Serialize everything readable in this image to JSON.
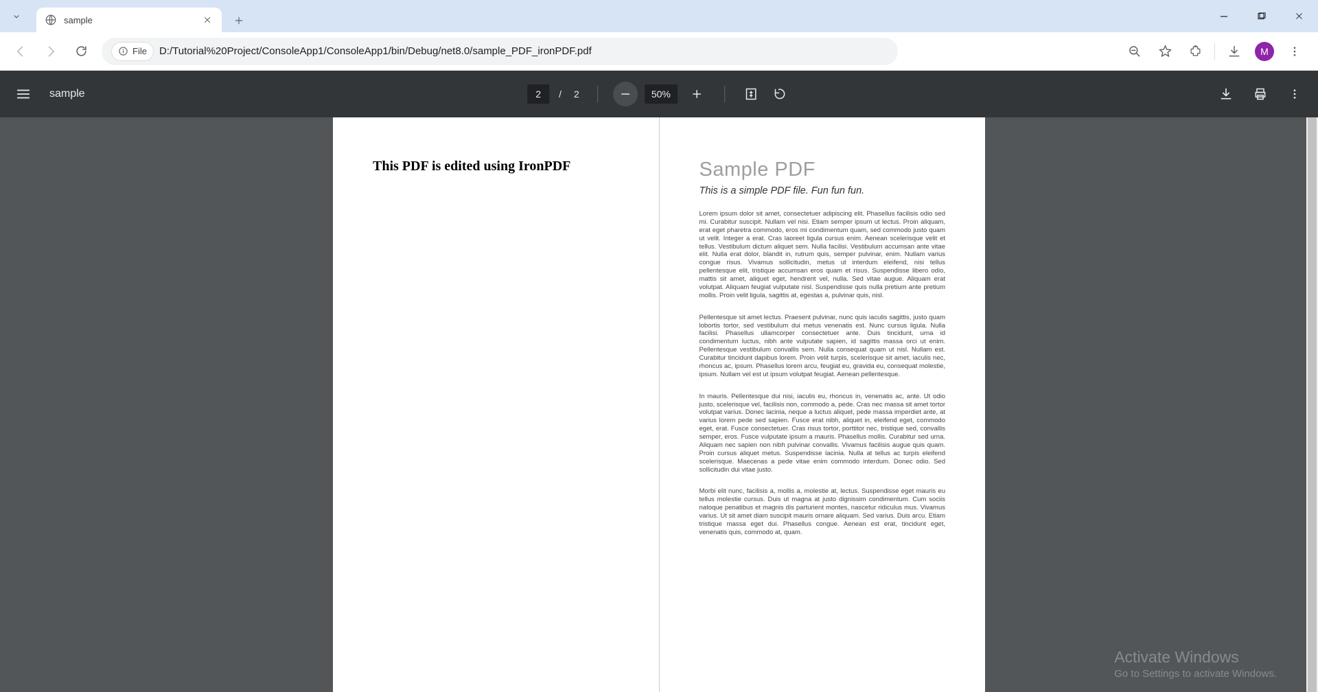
{
  "browser": {
    "tab_title": "sample",
    "url": "D:/Tutorial%20Project/ConsoleApp1/ConsoleApp1/bin/Debug/net8.0/sample_PDF_ironPDF.pdf",
    "origin_chip": "File",
    "avatar_letter": "M"
  },
  "pdf": {
    "doc_title": "sample",
    "page_current": "2",
    "page_sep": "/",
    "page_total": "2",
    "zoom": "50%",
    "left_page": {
      "heading": "This PDF is edited using IronPDF"
    },
    "right_page": {
      "title": "Sample PDF",
      "subtitle": "This is a simple PDF file. Fun fun fun.",
      "p1": "Lorem ipsum dolor sit amet, consectetuer adipiscing elit. Phasellus facilisis odio sed mi. Curabitur suscipit. Nullam vel nisi. Etiam semper ipsum ut lectus. Proin aliquam, erat eget pharetra commodo, eros mi condimentum quam, sed commodo justo quam ut velit. Integer a erat. Cras laoreet ligula cursus enim. Aenean scelerisque velit et tellus. Vestibulum dictum aliquet sem. Nulla facilisi. Vestibulum accumsan ante vitae elit. Nulla erat dolor, blandit in, rutrum quis, semper pulvinar, enim. Nullam varius congue risus. Vivamus sollicitudin, metus ut interdum eleifend, nisi tellus pellentesque elit, tristique accumsan eros quam et risus. Suspendisse libero odio, mattis sit amet, aliquet eget, hendrerit vel, nulla. Sed vitae augue. Aliquam erat volutpat. Aliquam feugiat vulputate nisl. Suspendisse quis nulla pretium ante pretium mollis. Proin velit ligula, sagittis at, egestas a, pulvinar quis, nisl.",
      "p2": "Pellentesque sit amet lectus. Praesent pulvinar, nunc quis iaculis sagittis, justo quam lobortis tortor, sed vestibulum dui metus venenatis est. Nunc cursus ligula. Nulla facilisi. Phasellus ullamcorper consectetuer ante. Duis tincidunt, urna id condimentum luctus, nibh ante vulputate sapien, id sagittis massa orci ut enim. Pellentesque vestibulum convallis sem. Nulla consequat quam ut nisl. Nullam est. Curabitur tincidunt dapibus lorem. Proin velit turpis, scelerisque sit amet, iaculis nec, rhoncus ac, ipsum. Phasellus lorem arcu, feugiat eu, gravida eu, consequat molestie, ipsum. Nullam vel est ut ipsum volutpat feugiat. Aenean pellentesque.",
      "p3": "In mauris. Pellentesque dui nisi, iaculis eu, rhoncus in, venenatis ac, ante. Ut odio justo, scelerisque vel, facilisis non, commodo a, pede. Cras nec massa sit amet tortor volutpat varius. Donec lacinia, neque a luctus aliquet, pede massa imperdiet ante, at varius lorem pede sed sapien. Fusce erat nibh, aliquet in, eleifend eget, commodo eget, erat. Fusce consectetuer. Cras risus tortor, porttitor nec, tristique sed, convallis semper, eros. Fusce vulputate ipsum a mauris. Phasellus mollis. Curabitur sed urna. Aliquam nec sapien non nibh pulvinar convallis. Vivamus facilisis augue quis quam. Proin cursus aliquet metus. Suspendisse lacinia. Nulla at tellus ac turpis eleifend scelerisque. Maecenas a pede vitae enim commodo interdum. Donec odio. Sed sollicitudin dui vitae justo.",
      "p4": "Morbi elit nunc, facilisis a, mollis a, molestie at, lectus. Suspendisse eget mauris eu tellus molestie cursus. Duis ut magna at justo dignissim condimentum. Cum sociis natoque penatibus et magnis dis parturient montes, nascetur ridiculus mus. Vivamus varius. Ut sit amet diam suscipit mauris ornare aliquam. Sed varius. Duis arcu. Etiam tristique massa eget dui. Phasellus congue. Aenean est erat, tincidunt eget, venenatis quis, commodo at, quam."
    }
  },
  "watermark": {
    "line1": "Activate Windows",
    "line2": "Go to Settings to activate Windows."
  }
}
